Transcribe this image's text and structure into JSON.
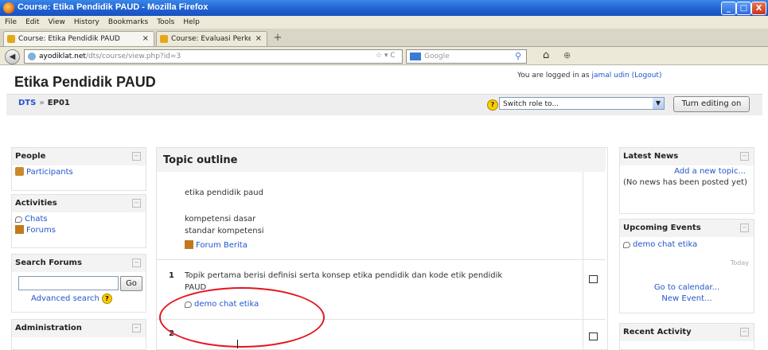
{
  "window": {
    "title": "Course: Etika Pendidik PAUD - Mozilla Firefox",
    "controls": [
      "_",
      "□",
      "X"
    ]
  },
  "menu": [
    "File",
    "Edit",
    "View",
    "History",
    "Bookmarks",
    "Tools",
    "Help"
  ],
  "tabs": [
    {
      "label": "Course: Etika Pendidik PAUD",
      "close": "×"
    },
    {
      "label": "Course: Evaluasi Perkembangan Anak Us...",
      "close": "×"
    }
  ],
  "new_tab": "+",
  "nav": {
    "back": "◀",
    "url_host": "ayodiklat.net",
    "url_path": "/dts/course/view.php?id=3",
    "url_icons": "☆ ▾ C",
    "search_placeholder": "Google",
    "home": "⌂",
    "addon": "⊕"
  },
  "page": {
    "title": "Etika Pendidik PAUD",
    "logged_in_prefix": "You are logged in as ",
    "user": "jamal udin",
    "logout": "(Logout)",
    "breadcrumb": [
      "DTS",
      "EP01"
    ],
    "breadcrumb_sep": "»",
    "role_icon": "?",
    "role_select": "Switch role to...",
    "turn_editing": "Turn editing on"
  },
  "blocks_left": {
    "people": {
      "title": "People",
      "items": [
        "Participants"
      ]
    },
    "activities": {
      "title": "Activities",
      "items": [
        "Chats",
        "Forums"
      ]
    },
    "search": {
      "title": "Search Forums",
      "go": "Go",
      "advanced": "Advanced search"
    },
    "admin": {
      "title": "Administration"
    }
  },
  "center": {
    "heading": "Topic outline",
    "section0": {
      "line1": "etika pendidik paud",
      "line2": "kompetensi dasar",
      "line3": "standar kompetensi",
      "forum": "Forum Berita"
    },
    "section1": {
      "number": "1",
      "text1": "Topik pertama berisi definisi serta konsep etika pendidik dan kode etik pendidik",
      "text2": "PAUD",
      "chat": "demo chat etika"
    },
    "section2": {
      "number": "2"
    }
  },
  "blocks_right": {
    "news": {
      "title": "Latest News",
      "add": "Add a new topic...",
      "empty": "(No news has been posted yet)"
    },
    "events": {
      "title": "Upcoming Events",
      "item": "demo chat etika",
      "when": "Today",
      "calendar": "Go to calendar...",
      "new_event": "New Event..."
    },
    "recent": {
      "title": "Recent Activity"
    }
  },
  "hide_glyph": "−",
  "colors": {
    "annotation": "#e5141e",
    "link": "#2255cc",
    "titlebar": "#1e5fd0"
  }
}
